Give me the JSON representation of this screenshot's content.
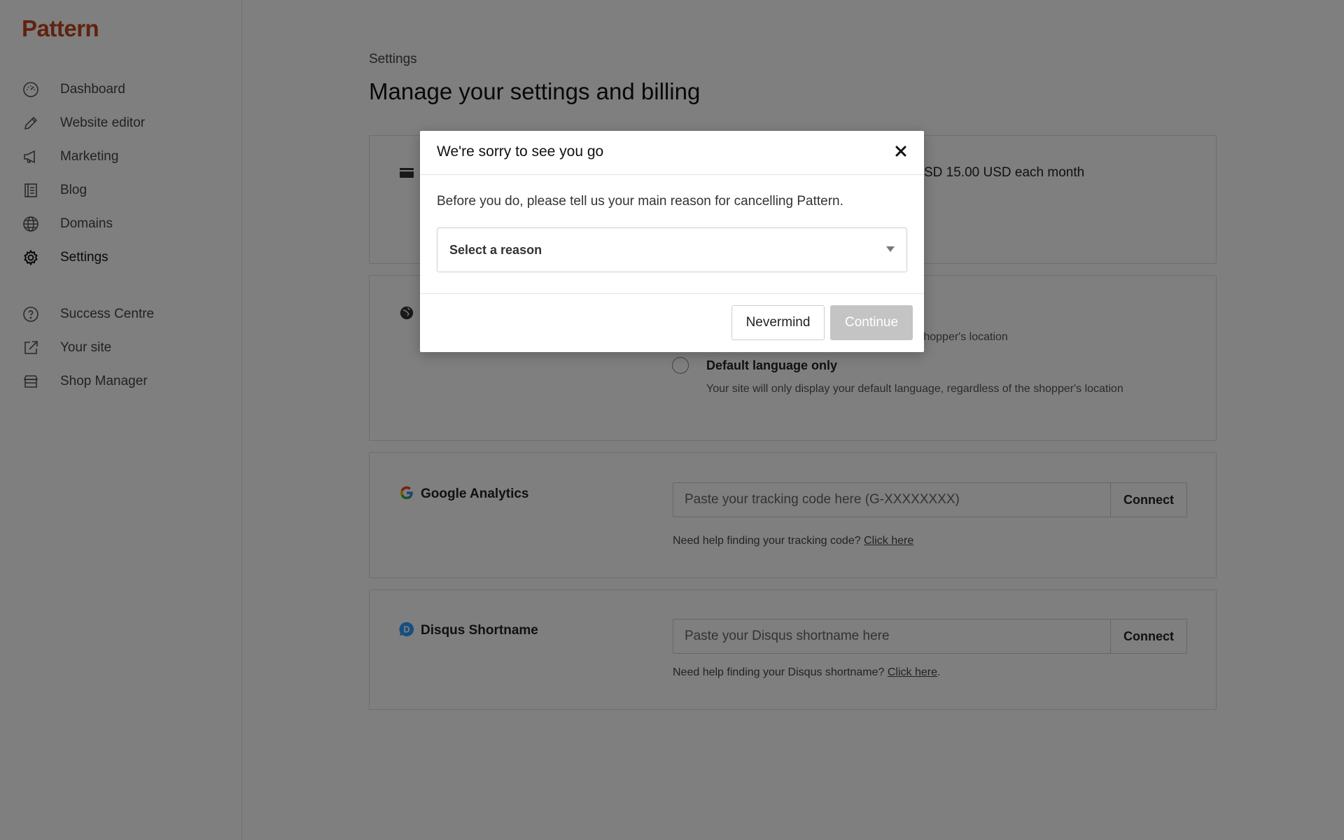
{
  "app": {
    "logo": "Pattern",
    "brand_color": "#c0461e"
  },
  "sidebar": {
    "items": [
      {
        "label": "Dashboard",
        "icon": "dashboard-gauge-icon",
        "active": false
      },
      {
        "label": "Website editor",
        "icon": "pencil-icon",
        "active": false
      },
      {
        "label": "Marketing",
        "icon": "megaphone-icon",
        "active": false
      },
      {
        "label": "Blog",
        "icon": "list-document-icon",
        "active": false
      },
      {
        "label": "Domains",
        "icon": "globe-icon",
        "active": false
      },
      {
        "label": "Settings",
        "icon": "gear-icon",
        "active": true
      }
    ],
    "secondary_items": [
      {
        "label": "Success Centre",
        "icon": "question-circle-icon"
      },
      {
        "label": "Your site",
        "icon": "external-link-icon"
      },
      {
        "label": "Shop Manager",
        "icon": "storefront-icon"
      }
    ]
  },
  "main": {
    "breadcrumb": "Settings",
    "title": "Manage your settings and billing",
    "billing": {
      "price_text": "SD 15.00 USD each month"
    },
    "language": {
      "option1_desc": "n shopper's location",
      "option2_title": "Default language only",
      "option2_desc": "Your site will only display your default language, regardless of the shopper's location"
    },
    "google_analytics": {
      "title": "Google Analytics",
      "placeholder": "Paste your tracking code here (G-XXXXXXXX)",
      "button": "Connect",
      "help": "Need help finding your tracking code?",
      "help_link": "Click here"
    },
    "disqus": {
      "title": "Disqus Shortname",
      "placeholder": "Paste your Disqus shortname here",
      "button": "Connect",
      "help": "Need help finding your Disqus shortname?",
      "help_link": "Click here",
      "help_suffix": "."
    }
  },
  "modal": {
    "title": "We're sorry to see you go",
    "description": "Before you do, please tell us your main reason for cancelling Pattern.",
    "select_placeholder": "Select a reason",
    "nevermind": "Nevermind",
    "continue": "Continue"
  }
}
